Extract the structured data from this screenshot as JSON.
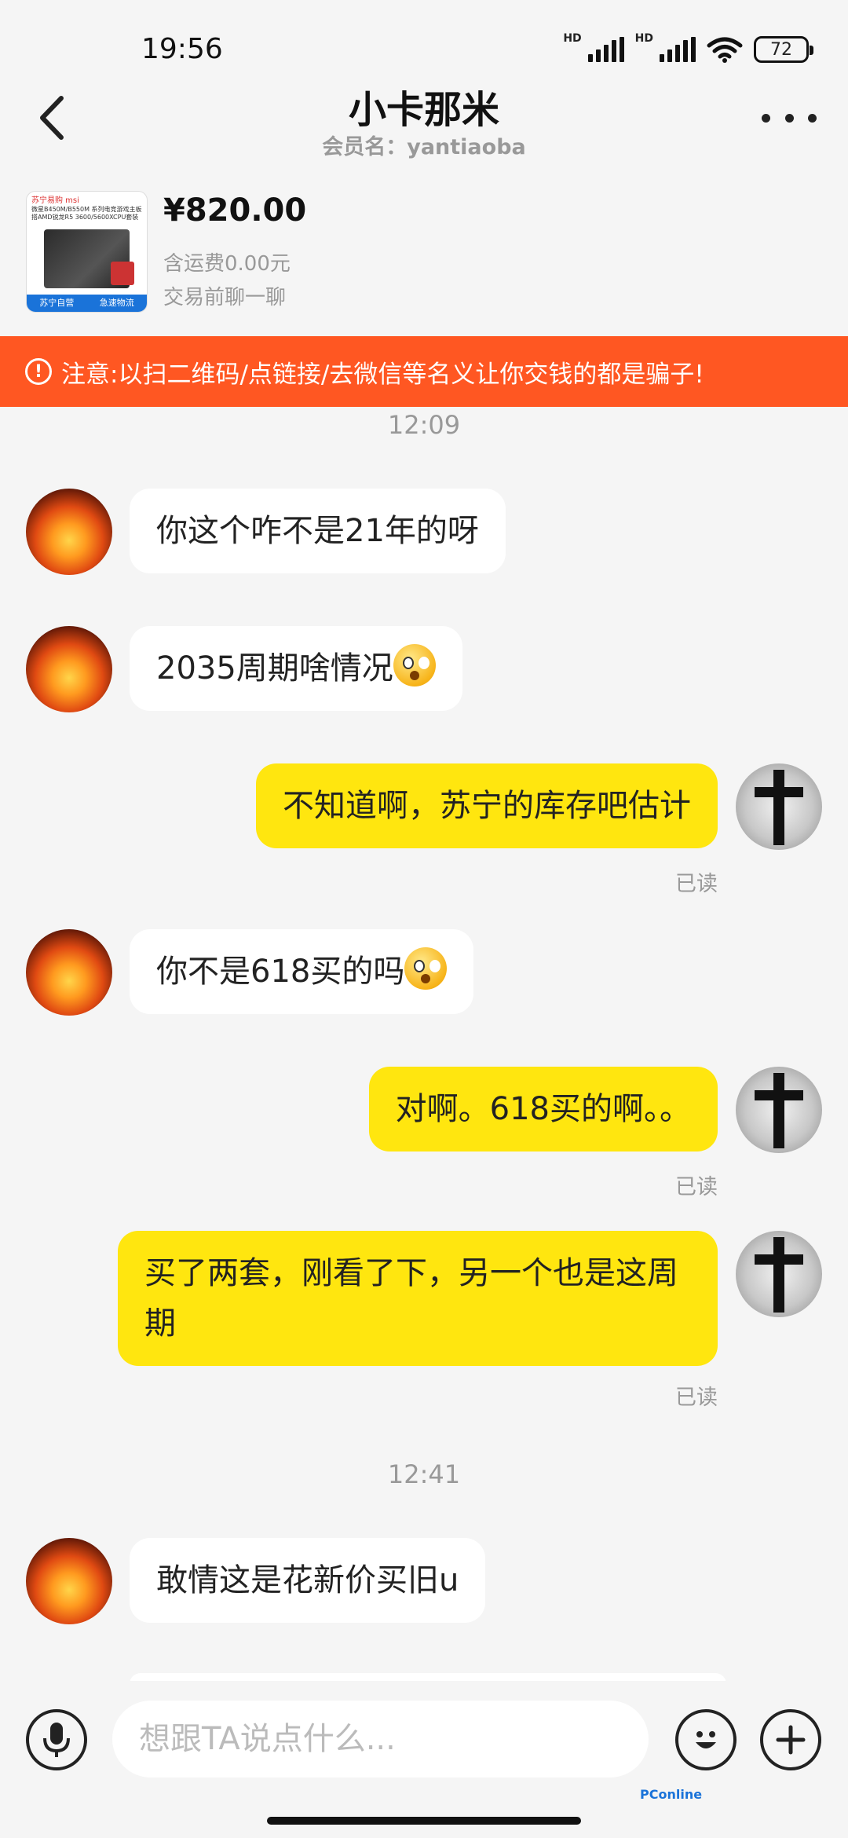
{
  "status_bar": {
    "time": "19:56",
    "hd1": "HD",
    "hd2": "HD",
    "battery": "72"
  },
  "header": {
    "title": "小卡那米",
    "member": "会员名：yantiaoba"
  },
  "product": {
    "thumb_top": "苏宁易购 msi",
    "thumb_text": "微星B450M/B550M 系列电竞游戏主板搭AMD锐龙R5 3600/5600XCPU套装",
    "thumb_badge_left": "苏宁自营",
    "thumb_badge_right": "急速物流",
    "price": "¥820.00",
    "shipping": "含运费0.00元",
    "pre_chat": "交易前聊一聊"
  },
  "warning": {
    "text": "注意:以扫二维码/点链接/去微信等名义让你交钱的都是骗子!"
  },
  "chat": {
    "time1": "12:09",
    "time2": "12:41",
    "m1": "你这个咋不是21年的呀",
    "m2": "2035周期啥情况",
    "m3": "不知道啊，苏宁的库存吧估计",
    "m4": "你不是618买的吗",
    "m5": "对啊。618买的啊。。",
    "m6": "买了两套，刚看了下，另一个也是这周期",
    "m7": "敢情这是花新价买旧u",
    "read": "已读"
  },
  "input": {
    "placeholder": "想跟TA说点什么..."
  },
  "watermark": "PConline",
  "colors": {
    "warning_bg": "#ff5722",
    "my_bubble": "#ffe60f",
    "other_bubble": "#ffffff",
    "background": "#f5f5f5"
  },
  "icons": [
    "back-arrow-icon",
    "more-icon",
    "alert-icon",
    "microphone-icon",
    "emoji-icon",
    "plus-icon"
  ]
}
